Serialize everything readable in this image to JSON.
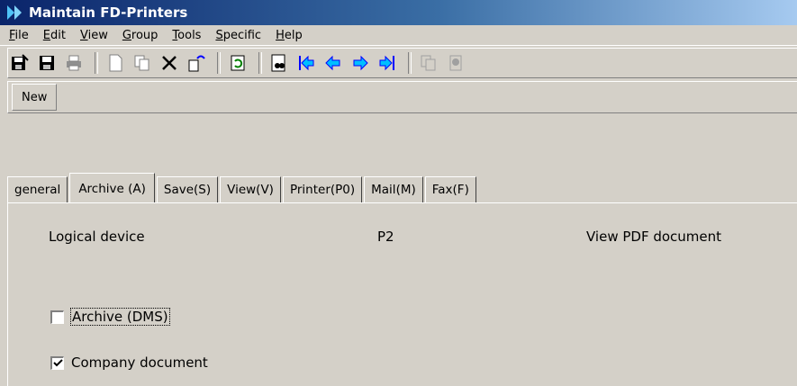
{
  "window": {
    "title": "Maintain FD-Printers"
  },
  "menu": [
    {
      "pre": "",
      "u": "F",
      "post": "ile"
    },
    {
      "pre": "",
      "u": "E",
      "post": "dit"
    },
    {
      "pre": "",
      "u": "V",
      "post": "iew"
    },
    {
      "pre": "",
      "u": "G",
      "post": "roup"
    },
    {
      "pre": "",
      "u": "T",
      "post": "ools"
    },
    {
      "pre": "",
      "u": "S",
      "post": "pecific"
    },
    {
      "pre": "",
      "u": "H",
      "post": "elp"
    }
  ],
  "toolbar": {
    "icons": [
      "save-exit-icon",
      "save-icon",
      "print-icon",
      "new-document-icon",
      "copy-icon",
      "delete-icon",
      "undo-edit-icon",
      "refresh-icon",
      "find-icon",
      "first-record-icon",
      "previous-record-icon",
      "next-record-icon",
      "last-record-icon",
      "copy-disabled-icon",
      "paste-disabled-icon"
    ]
  },
  "newbar": {
    "new_label": "New"
  },
  "tabs": [
    {
      "label": "general",
      "active": false
    },
    {
      "label": "Archive (A)",
      "active": true
    },
    {
      "label": "Save(S)",
      "active": false
    },
    {
      "label": "View(V)",
      "active": false
    },
    {
      "label": "Printer(P0)",
      "active": false
    },
    {
      "label": "Mail(M)",
      "active": false
    },
    {
      "label": "Fax(F)",
      "active": false
    }
  ],
  "panel": {
    "logical_device_label": "Logical device",
    "logical_device_value": "P2",
    "view_pdf_label": "View PDF document",
    "archive_dms_label": "Archive (DMS)",
    "archive_dms_checked": false,
    "company_document_label": "Company document",
    "company_document_checked": true
  }
}
